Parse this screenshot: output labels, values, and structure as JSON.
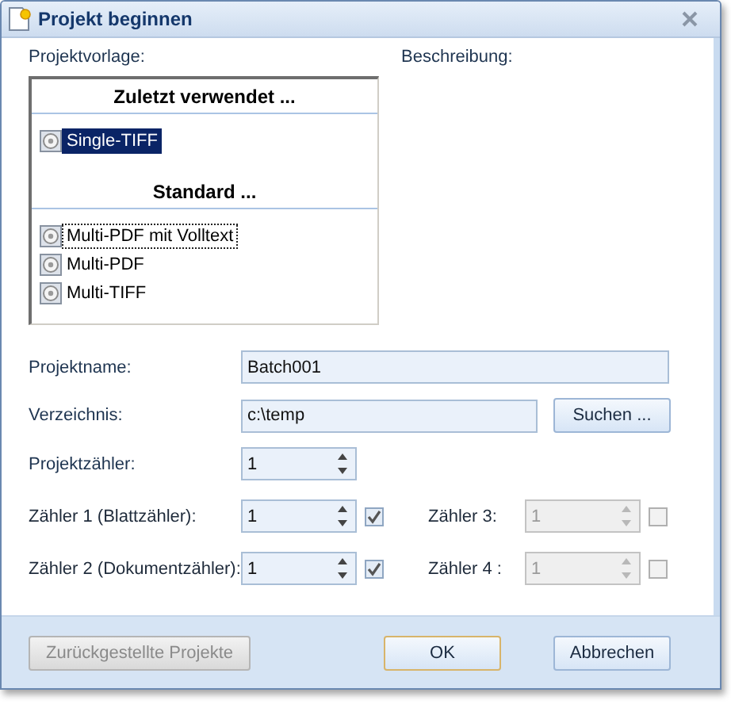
{
  "window": {
    "title": "Projekt beginnen"
  },
  "template_label": "Projektvorlage:",
  "description_label": "Beschreibung:",
  "template_list": {
    "groups": [
      {
        "heading": "Zuletzt verwendet ...",
        "items": [
          {
            "label": "Single-TIFF",
            "selected": true,
            "focused": false
          }
        ]
      },
      {
        "heading": "Standard ...",
        "items": [
          {
            "label": "Multi-PDF mit Volltext",
            "selected": false,
            "focused": true
          },
          {
            "label": "Multi-PDF",
            "selected": false,
            "focused": false
          },
          {
            "label": "Multi-TIFF",
            "selected": false,
            "focused": false
          }
        ]
      }
    ]
  },
  "fields": [
    {
      "kind": "text",
      "label": "Projektname:",
      "value": "Batch001"
    },
    {
      "kind": "browse",
      "label": "Verzeichnis:",
      "value": "c:\\temp",
      "button": "Suchen ..."
    },
    {
      "kind": "spin",
      "label": "Projektzähler:",
      "value": "1"
    }
  ],
  "counters": [
    {
      "label": "Zähler 1 (Blattzähler):",
      "value": "1",
      "checked": true,
      "disabled": false
    },
    {
      "label": "Zähler 3:",
      "value": "1",
      "checked": false,
      "disabled": true
    },
    {
      "label": "Zähler 2 (Dokumentzähler):",
      "value": "1",
      "checked": true,
      "disabled": false
    },
    {
      "label": "Zähler 4 :",
      "value": "1",
      "checked": false,
      "disabled": true
    }
  ],
  "buttons": [
    {
      "label": "Zurückgestellte Projekte",
      "disabled": true,
      "default": false
    },
    {
      "label": "OK",
      "disabled": false,
      "default": true
    },
    {
      "label": "Abbrechen",
      "disabled": false,
      "default": false
    }
  ]
}
